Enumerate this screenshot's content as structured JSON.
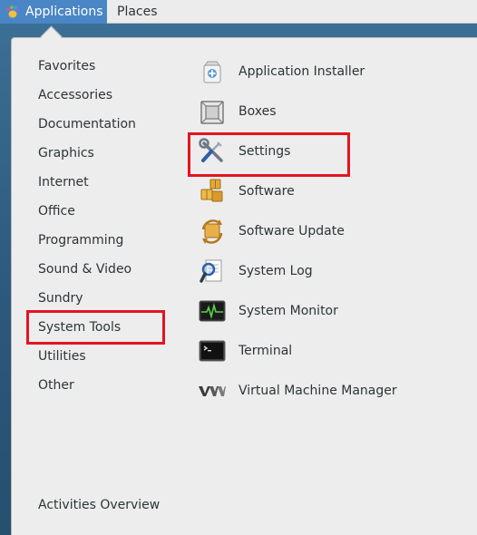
{
  "topbar": {
    "applications_label": "Applications",
    "places_label": "Places"
  },
  "menu": {
    "categories": [
      "Favorites",
      "Accessories",
      "Documentation",
      "Graphics",
      "Internet",
      "Office",
      "Programming",
      "Sound & Video",
      "Sundry",
      "System Tools",
      "Utilities",
      "Other"
    ],
    "selected_category": "System Tools",
    "apps": [
      {
        "label": "Application Installer",
        "icon": "package-installer-icon"
      },
      {
        "label": "Boxes",
        "icon": "boxes-icon"
      },
      {
        "label": "Settings",
        "icon": "settings-tools-icon"
      },
      {
        "label": "Software",
        "icon": "software-packages-icon"
      },
      {
        "label": "Software Update",
        "icon": "software-update-icon"
      },
      {
        "label": "System Log",
        "icon": "system-log-icon"
      },
      {
        "label": "System Monitor",
        "icon": "system-monitor-icon"
      },
      {
        "label": "Terminal",
        "icon": "terminal-icon"
      },
      {
        "label": "Virtual Machine Manager",
        "icon": "virt-manager-icon"
      }
    ],
    "highlighted_app": "Settings",
    "activities_overview_label": "Activities Overview"
  },
  "colors": {
    "accent": "#4a86c5",
    "highlight_box": "#e3141f",
    "menu_background": "#ededed"
  }
}
